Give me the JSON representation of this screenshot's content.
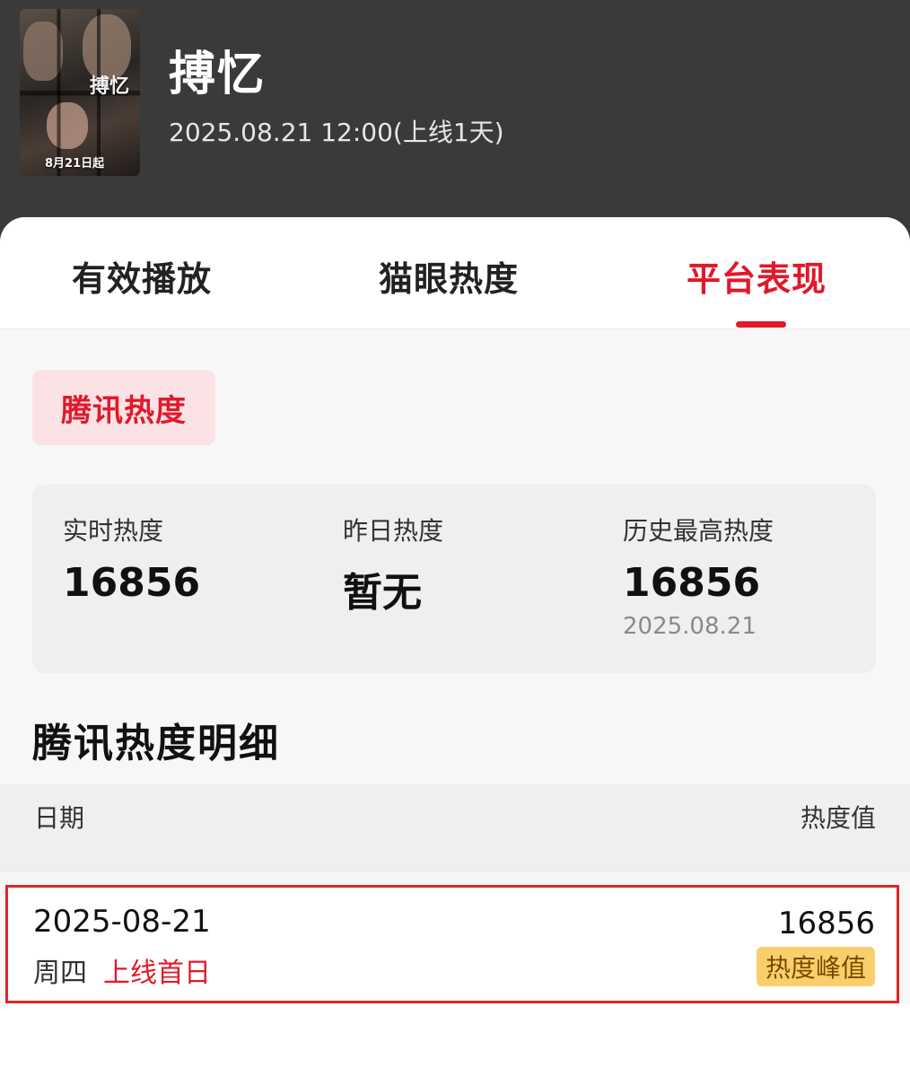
{
  "header": {
    "title": "搏忆",
    "subtitle": "2025.08.21 12:00(上线1天)",
    "poster": {
      "title_text": "搏忆",
      "date_text": "8月21日起"
    }
  },
  "tabs": [
    {
      "label": "有效播放",
      "active": false
    },
    {
      "label": "猫眼热度",
      "active": false
    },
    {
      "label": "平台表现",
      "active": true
    }
  ],
  "platform_chip": {
    "label": "腾讯热度"
  },
  "stats": {
    "realtime": {
      "label": "实时热度",
      "value": "16856"
    },
    "yesterday": {
      "label": "昨日热度",
      "value": "暂无"
    },
    "history_max": {
      "label": "历史最高热度",
      "value": "16856",
      "date": "2025.08.21"
    }
  },
  "detail": {
    "title": "腾讯热度明细",
    "columns": {
      "date": "日期",
      "value": "热度值"
    },
    "rows": [
      {
        "date": "2025-08-21",
        "weekday": "周四",
        "tag": "上线首日",
        "value": "16856",
        "badge": "热度峰值"
      }
    ]
  },
  "colors": {
    "accent": "#e0192b",
    "badge": "#f8cf6b",
    "header_bg": "#3a3a3a"
  }
}
